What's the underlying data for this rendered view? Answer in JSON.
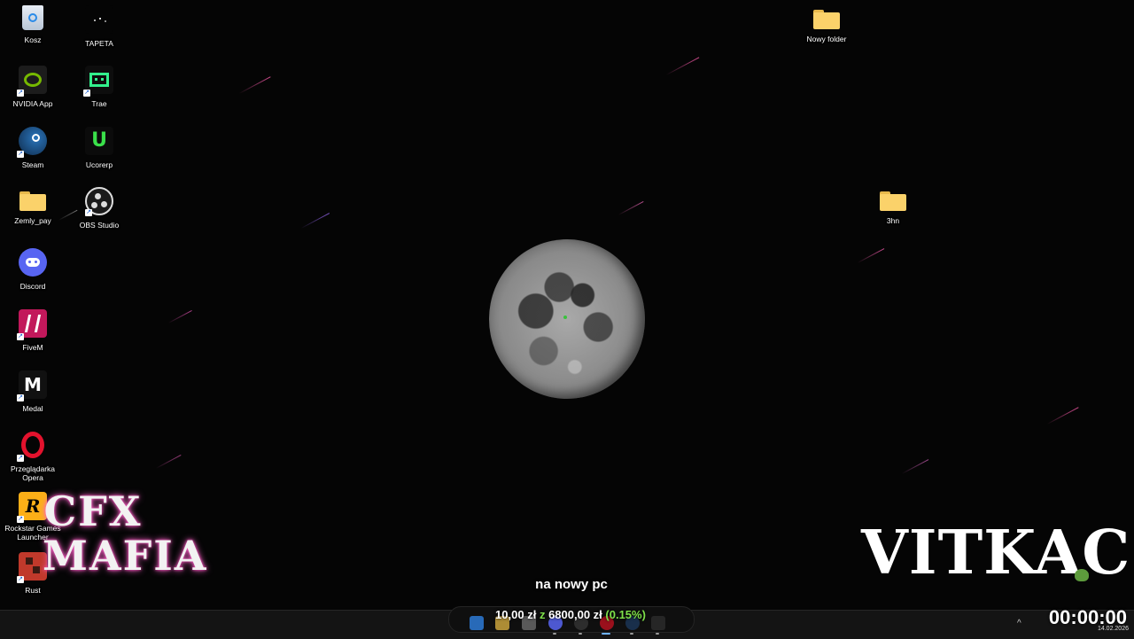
{
  "desktop": {
    "icons": [
      {
        "label": "Kosz",
        "icon": "recycle-bin-icon"
      },
      {
        "label": "TAPETA",
        "icon": "wallpaper-icon"
      },
      {
        "label": "NVIDIA App",
        "icon": "nvidia-icon"
      },
      {
        "label": "Trae",
        "icon": "trae-icon"
      },
      {
        "label": "Steam",
        "icon": "steam-icon"
      },
      {
        "label": "Ucorerp",
        "icon": "ucorerp-icon"
      },
      {
        "label": "Zemly_pay",
        "icon": "folder-icon"
      },
      {
        "label": "OBS Studio",
        "icon": "obs-icon"
      },
      {
        "label": "Discord",
        "icon": "discord-icon"
      },
      {
        "label": "FiveM",
        "icon": "fivem-icon"
      },
      {
        "label": "Medal",
        "icon": "medal-icon"
      },
      {
        "label": "Przeglądarka Opera",
        "icon": "opera-icon"
      },
      {
        "label": "Rockstar Games Launcher",
        "icon": "rockstar-icon"
      },
      {
        "label": "Rust",
        "icon": "rust-icon"
      },
      {
        "label": "Nowy folder",
        "icon": "folder-icon"
      },
      {
        "label": "3hn",
        "icon": "folder-icon"
      }
    ]
  },
  "overlay": {
    "cfx_logo": "CFX MAFIA",
    "brand": "VITKAC",
    "caption": "na nowy pc",
    "donation": {
      "current": "10,00 zł",
      "separator": "z",
      "goal": "6800,00 zł",
      "percent": "(0.15%)"
    },
    "timer": "00:00:00"
  },
  "taskbar": {
    "date": "14.02.2026",
    "tray_chevron": "^",
    "icons": [
      "start-icon",
      "file-explorer-icon",
      "notepad-icon",
      "discord-icon",
      "obs-icon",
      "opera-icon",
      "steam-icon",
      "app-icon"
    ]
  },
  "colors": {
    "background": "#050505",
    "folder": "#fbd26a",
    "donation_green": "#7ee04a",
    "taskbar": "#141414"
  }
}
